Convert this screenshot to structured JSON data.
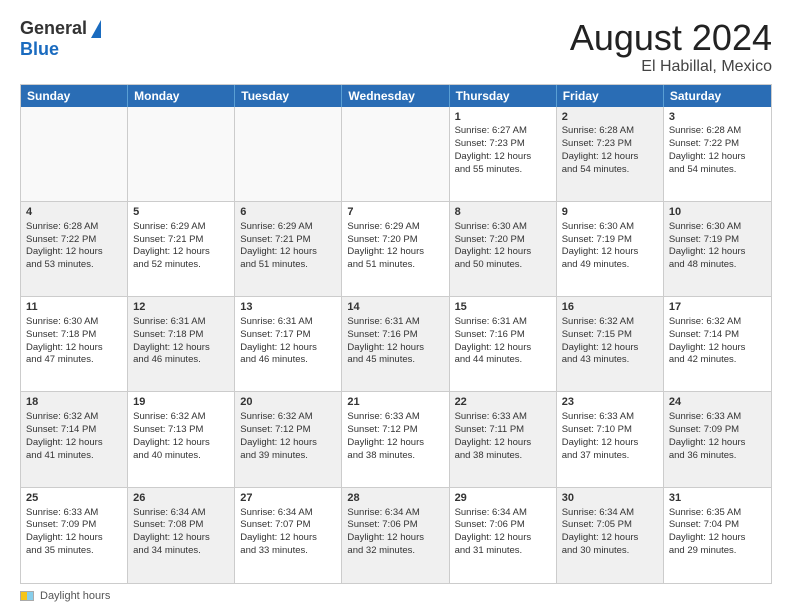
{
  "header": {
    "logo": {
      "general": "General",
      "blue": "Blue"
    },
    "month_year": "August 2024",
    "location": "El Habillal, Mexico"
  },
  "days_of_week": [
    "Sunday",
    "Monday",
    "Tuesday",
    "Wednesday",
    "Thursday",
    "Friday",
    "Saturday"
  ],
  "footer": {
    "label": "Daylight hours"
  },
  "weeks": [
    [
      {
        "day": "",
        "info": "",
        "empty": true
      },
      {
        "day": "",
        "info": "",
        "empty": true
      },
      {
        "day": "",
        "info": "",
        "empty": true
      },
      {
        "day": "",
        "info": "",
        "empty": true
      },
      {
        "day": "1",
        "info": "Sunrise: 6:27 AM\nSunset: 7:23 PM\nDaylight: 12 hours\nand 55 minutes.",
        "empty": false,
        "shaded": false
      },
      {
        "day": "2",
        "info": "Sunrise: 6:28 AM\nSunset: 7:23 PM\nDaylight: 12 hours\nand 54 minutes.",
        "empty": false,
        "shaded": true
      },
      {
        "day": "3",
        "info": "Sunrise: 6:28 AM\nSunset: 7:22 PM\nDaylight: 12 hours\nand 54 minutes.",
        "empty": false,
        "shaded": false
      }
    ],
    [
      {
        "day": "4",
        "info": "Sunrise: 6:28 AM\nSunset: 7:22 PM\nDaylight: 12 hours\nand 53 minutes.",
        "empty": false,
        "shaded": true
      },
      {
        "day": "5",
        "info": "Sunrise: 6:29 AM\nSunset: 7:21 PM\nDaylight: 12 hours\nand 52 minutes.",
        "empty": false,
        "shaded": false
      },
      {
        "day": "6",
        "info": "Sunrise: 6:29 AM\nSunset: 7:21 PM\nDaylight: 12 hours\nand 51 minutes.",
        "empty": false,
        "shaded": true
      },
      {
        "day": "7",
        "info": "Sunrise: 6:29 AM\nSunset: 7:20 PM\nDaylight: 12 hours\nand 51 minutes.",
        "empty": false,
        "shaded": false
      },
      {
        "day": "8",
        "info": "Sunrise: 6:30 AM\nSunset: 7:20 PM\nDaylight: 12 hours\nand 50 minutes.",
        "empty": false,
        "shaded": true
      },
      {
        "day": "9",
        "info": "Sunrise: 6:30 AM\nSunset: 7:19 PM\nDaylight: 12 hours\nand 49 minutes.",
        "empty": false,
        "shaded": false
      },
      {
        "day": "10",
        "info": "Sunrise: 6:30 AM\nSunset: 7:19 PM\nDaylight: 12 hours\nand 48 minutes.",
        "empty": false,
        "shaded": true
      }
    ],
    [
      {
        "day": "11",
        "info": "Sunrise: 6:30 AM\nSunset: 7:18 PM\nDaylight: 12 hours\nand 47 minutes.",
        "empty": false,
        "shaded": false
      },
      {
        "day": "12",
        "info": "Sunrise: 6:31 AM\nSunset: 7:18 PM\nDaylight: 12 hours\nand 46 minutes.",
        "empty": false,
        "shaded": true
      },
      {
        "day": "13",
        "info": "Sunrise: 6:31 AM\nSunset: 7:17 PM\nDaylight: 12 hours\nand 46 minutes.",
        "empty": false,
        "shaded": false
      },
      {
        "day": "14",
        "info": "Sunrise: 6:31 AM\nSunset: 7:16 PM\nDaylight: 12 hours\nand 45 minutes.",
        "empty": false,
        "shaded": true
      },
      {
        "day": "15",
        "info": "Sunrise: 6:31 AM\nSunset: 7:16 PM\nDaylight: 12 hours\nand 44 minutes.",
        "empty": false,
        "shaded": false
      },
      {
        "day": "16",
        "info": "Sunrise: 6:32 AM\nSunset: 7:15 PM\nDaylight: 12 hours\nand 43 minutes.",
        "empty": false,
        "shaded": true
      },
      {
        "day": "17",
        "info": "Sunrise: 6:32 AM\nSunset: 7:14 PM\nDaylight: 12 hours\nand 42 minutes.",
        "empty": false,
        "shaded": false
      }
    ],
    [
      {
        "day": "18",
        "info": "Sunrise: 6:32 AM\nSunset: 7:14 PM\nDaylight: 12 hours\nand 41 minutes.",
        "empty": false,
        "shaded": true
      },
      {
        "day": "19",
        "info": "Sunrise: 6:32 AM\nSunset: 7:13 PM\nDaylight: 12 hours\nand 40 minutes.",
        "empty": false,
        "shaded": false
      },
      {
        "day": "20",
        "info": "Sunrise: 6:32 AM\nSunset: 7:12 PM\nDaylight: 12 hours\nand 39 minutes.",
        "empty": false,
        "shaded": true
      },
      {
        "day": "21",
        "info": "Sunrise: 6:33 AM\nSunset: 7:12 PM\nDaylight: 12 hours\nand 38 minutes.",
        "empty": false,
        "shaded": false
      },
      {
        "day": "22",
        "info": "Sunrise: 6:33 AM\nSunset: 7:11 PM\nDaylight: 12 hours\nand 38 minutes.",
        "empty": false,
        "shaded": true
      },
      {
        "day": "23",
        "info": "Sunrise: 6:33 AM\nSunset: 7:10 PM\nDaylight: 12 hours\nand 37 minutes.",
        "empty": false,
        "shaded": false
      },
      {
        "day": "24",
        "info": "Sunrise: 6:33 AM\nSunset: 7:09 PM\nDaylight: 12 hours\nand 36 minutes.",
        "empty": false,
        "shaded": true
      }
    ],
    [
      {
        "day": "25",
        "info": "Sunrise: 6:33 AM\nSunset: 7:09 PM\nDaylight: 12 hours\nand 35 minutes.",
        "empty": false,
        "shaded": false
      },
      {
        "day": "26",
        "info": "Sunrise: 6:34 AM\nSunset: 7:08 PM\nDaylight: 12 hours\nand 34 minutes.",
        "empty": false,
        "shaded": true
      },
      {
        "day": "27",
        "info": "Sunrise: 6:34 AM\nSunset: 7:07 PM\nDaylight: 12 hours\nand 33 minutes.",
        "empty": false,
        "shaded": false
      },
      {
        "day": "28",
        "info": "Sunrise: 6:34 AM\nSunset: 7:06 PM\nDaylight: 12 hours\nand 32 minutes.",
        "empty": false,
        "shaded": true
      },
      {
        "day": "29",
        "info": "Sunrise: 6:34 AM\nSunset: 7:06 PM\nDaylight: 12 hours\nand 31 minutes.",
        "empty": false,
        "shaded": false
      },
      {
        "day": "30",
        "info": "Sunrise: 6:34 AM\nSunset: 7:05 PM\nDaylight: 12 hours\nand 30 minutes.",
        "empty": false,
        "shaded": true
      },
      {
        "day": "31",
        "info": "Sunrise: 6:35 AM\nSunset: 7:04 PM\nDaylight: 12 hours\nand 29 minutes.",
        "empty": false,
        "shaded": false
      }
    ]
  ]
}
